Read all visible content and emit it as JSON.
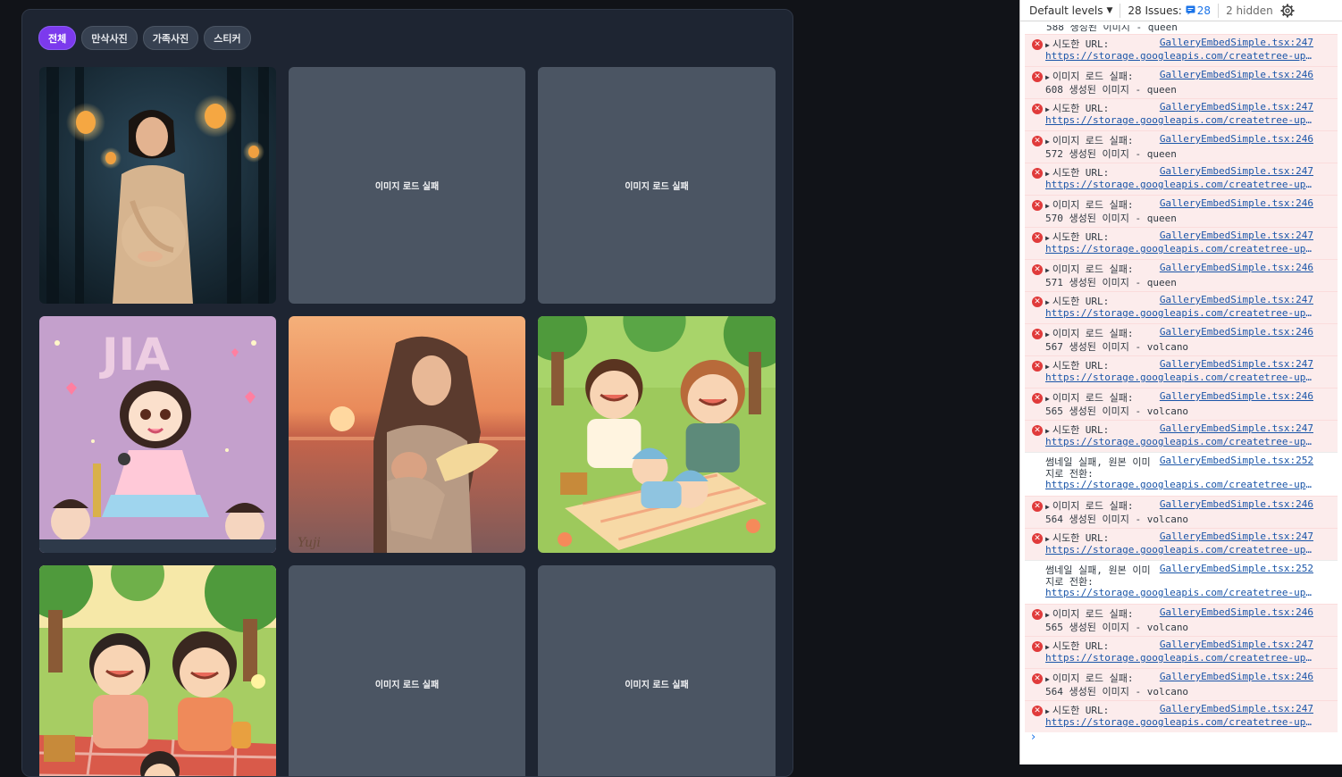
{
  "gallery": {
    "tabs": [
      {
        "label": "전체",
        "active": true
      },
      {
        "label": "만삭사진",
        "active": false
      },
      {
        "label": "가족사진",
        "active": false
      },
      {
        "label": "스티커",
        "active": false
      }
    ],
    "failed_label": "이미지 로드 실패",
    "cells": [
      {
        "kind": "image",
        "name": "pregnant-woman-lantern-forest-image"
      },
      {
        "kind": "failed"
      },
      {
        "kind": "failed"
      },
      {
        "kind": "image",
        "name": "cartoon-girl-singing-jia-image"
      },
      {
        "kind": "image",
        "name": "mother-holding-angel-baby-sunset-image"
      },
      {
        "kind": "image",
        "name": "cartoon-family-picnic-image"
      },
      {
        "kind": "image",
        "name": "cartoon-family-picnic-forest-image"
      },
      {
        "kind": "failed"
      },
      {
        "kind": "failed"
      }
    ],
    "image_texts": {
      "jia_banner": "JIA",
      "signature": "Yuji"
    }
  },
  "devtools": {
    "toolbar": {
      "levels": "Default levels",
      "issues_label": "28 Issues:",
      "issues_count": "28",
      "hidden": "2 hidden"
    },
    "cut_row_text": "588 생성된 이미지 - queen",
    "entries": [
      {
        "type": "error",
        "line1": "시도한 URL:",
        "src": "GalleryEmbedSimple.tsx:247",
        "line2": "https://storage.googleapis.com/createtree-upload",
        "url": true
      },
      {
        "type": "error",
        "line1": "이미지 로드 실패:",
        "src": "GalleryEmbedSimple.tsx:246",
        "line2": "608 생성된 이미지 - queen",
        "url": false
      },
      {
        "type": "error",
        "line1": "시도한 URL:",
        "src": "GalleryEmbedSimple.tsx:247",
        "line2": "https://storage.googleapis.com/createtree-upload",
        "url": true
      },
      {
        "type": "error",
        "line1": "이미지 로드 실패:",
        "src": "GalleryEmbedSimple.tsx:246",
        "line2": "572 생성된 이미지 - queen",
        "url": false
      },
      {
        "type": "error",
        "line1": "시도한 URL:",
        "src": "GalleryEmbedSimple.tsx:247",
        "line2": "https://storage.googleapis.com/createtree-upload",
        "url": true
      },
      {
        "type": "error",
        "line1": "이미지 로드 실패:",
        "src": "GalleryEmbedSimple.tsx:246",
        "line2": "570 생성된 이미지 - queen",
        "url": false
      },
      {
        "type": "error",
        "line1": "시도한 URL:",
        "src": "GalleryEmbedSimple.tsx:247",
        "line2": "https://storage.googleapis.com/createtree-upload",
        "url": true
      },
      {
        "type": "error",
        "line1": "이미지 로드 실패:",
        "src": "GalleryEmbedSimple.tsx:246",
        "line2": "571 생성된 이미지 - queen",
        "url": false
      },
      {
        "type": "error",
        "line1": "시도한 URL:",
        "src": "GalleryEmbedSimple.tsx:247",
        "line2": "https://storage.googleapis.com/createtree-upload",
        "url": true
      },
      {
        "type": "error",
        "line1": "이미지 로드 실패:",
        "src": "GalleryEmbedSimple.tsx:246",
        "line2": "567 생성된 이미지 - volcano",
        "url": false
      },
      {
        "type": "error",
        "line1": "시도한 URL:",
        "src": "GalleryEmbedSimple.tsx:247",
        "line2": "https://storage.googleapis.com/createtree-upload",
        "url": true
      },
      {
        "type": "error",
        "line1": "이미지 로드 실패:",
        "src": "GalleryEmbedSimple.tsx:246",
        "line2": "565 생성된 이미지 - volcano",
        "url": false
      },
      {
        "type": "error",
        "line1": "시도한 URL:",
        "src": "GalleryEmbedSimple.tsx:247",
        "line2": "https://storage.googleapis.com/createtree-upload",
        "url": true
      },
      {
        "type": "log",
        "line1": "썸네일 실패, 원본 이미",
        "line2": "지로 전환:",
        "line3": "https://storage.googleapis.com/createtree-upload",
        "src": "GalleryEmbedSimple.tsx:252"
      },
      {
        "type": "error",
        "line1": "이미지 로드 실패:",
        "src": "GalleryEmbedSimple.tsx:246",
        "line2": "564 생성된 이미지 - volcano",
        "url": false
      },
      {
        "type": "error",
        "line1": "시도한 URL:",
        "src": "GalleryEmbedSimple.tsx:247",
        "line2": "https://storage.googleapis.com/createtree-upload",
        "url": true
      },
      {
        "type": "log",
        "line1": "썸네일 실패, 원본 이미",
        "line2": "지로 전환:",
        "line3": "https://storage.googleapis.com/createtree-upload",
        "src": "GalleryEmbedSimple.tsx:252"
      },
      {
        "type": "error",
        "line1": "이미지 로드 실패:",
        "src": "GalleryEmbedSimple.tsx:246",
        "line2": "565 생성된 이미지 - volcano",
        "url": false
      },
      {
        "type": "error",
        "line1": "시도한 URL:",
        "src": "GalleryEmbedSimple.tsx:247",
        "line2": "https://storage.googleapis.com/createtree-upload",
        "url": true
      },
      {
        "type": "error",
        "line1": "이미지 로드 실패:",
        "src": "GalleryEmbedSimple.tsx:246",
        "line2": "564 생성된 이미지 - volcano",
        "url": false
      },
      {
        "type": "error",
        "line1": "시도한 URL:",
        "src": "GalleryEmbedSimple.tsx:247",
        "line2": "https://storage.googleapis.com/createtree-upload",
        "url": true
      }
    ],
    "prompt_symbol": "›"
  }
}
